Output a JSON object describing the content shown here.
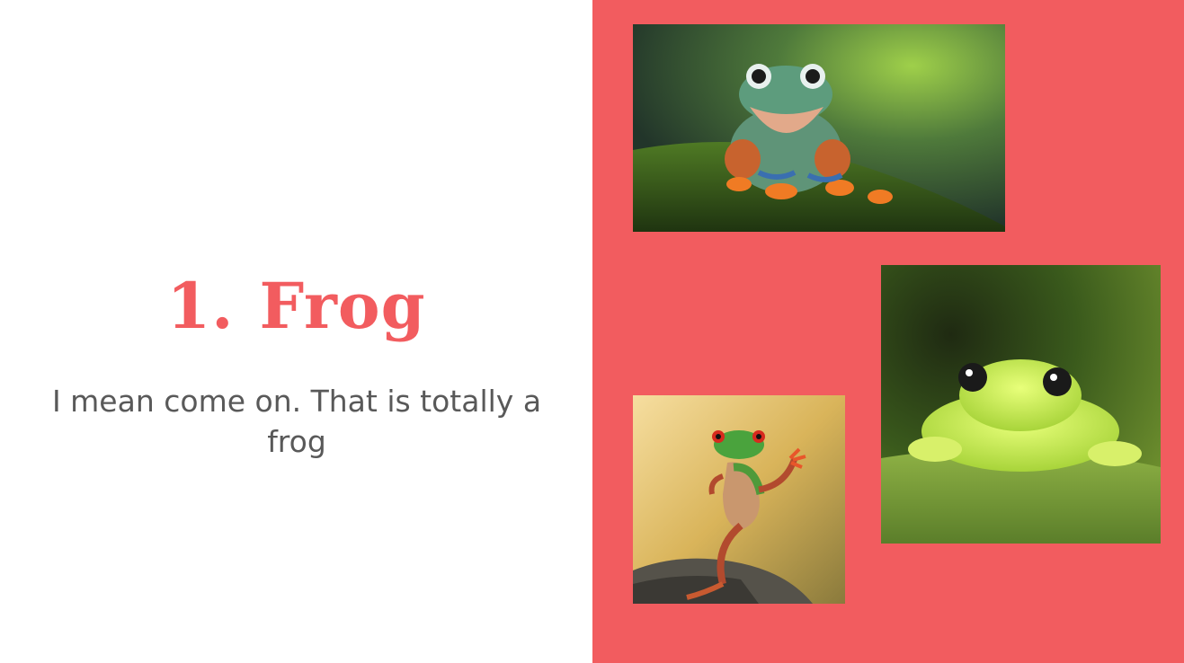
{
  "slide": {
    "title_number": "1.",
    "title_text": "Frog",
    "body": "I mean come on. That is totally a frog"
  },
  "colors": {
    "accent": "#f25c5f",
    "body_text": "#595959",
    "background": "#ffffff"
  },
  "images": [
    {
      "name": "smiling-tree-frog-on-moss-photo"
    },
    {
      "name": "glass-frog-on-leaf-photo"
    },
    {
      "name": "red-eyed-tree-frog-on-rock-photo"
    }
  ]
}
